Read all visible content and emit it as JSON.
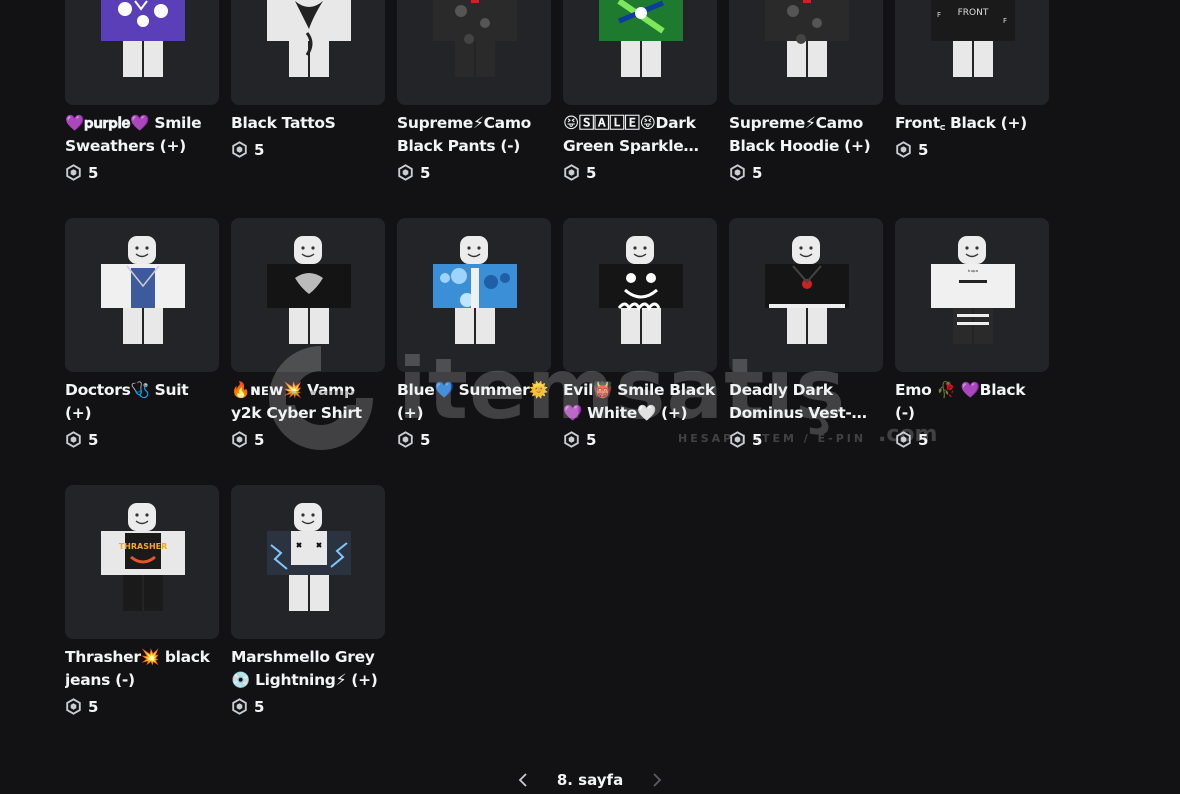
{
  "items": [
    {
      "name": "💜𝐩𝐮𝐫𝐩𝐥𝐞💜 Smile Sweathers (+)",
      "price": "5",
      "shirt": "#5b3fb8",
      "pattern": "purple",
      "legs": "#e8e8e8"
    },
    {
      "name": "Black TattoS",
      "price": "5",
      "shirt": "#e8e8e8",
      "pattern": "tattoo",
      "legs": "#e8e8e8"
    },
    {
      "name": "Supreme⚡Camo Black Pants (-)",
      "price": "5",
      "shirt": "#2a2a2a",
      "pattern": "camo",
      "legs": "#2a2a2a"
    },
    {
      "name": "😝🅂🄰🄻🄴😝Dark Green Sparkle Hoodie",
      "price": "5",
      "shirt": "#1d7a2e",
      "pattern": "green",
      "legs": "#e8e8e8"
    },
    {
      "name": "Supreme⚡Camo Black Hoodie (+)",
      "price": "5",
      "shirt": "#2a2a2a",
      "pattern": "camo",
      "legs": "#e8e8e8"
    },
    {
      "name": "Front꜀ Black (+)",
      "price": "5",
      "shirt": "#1a1a1a",
      "pattern": "front",
      "legs": "#e8e8e8"
    },
    {
      "name": "Doctors🩺 Suit (+)",
      "price": "5",
      "shirt": "#f0f0f0",
      "pattern": "doctor",
      "legs": "#e8e8e8"
    },
    {
      "name": "🔥ɴᴇᴡ💥 Vamp y2k Cyber Shirt",
      "price": "5",
      "shirt": "#141414",
      "pattern": "vamp",
      "legs": "#e8e8e8"
    },
    {
      "name": "Blue💙 Summer🌞 (+)",
      "price": "5",
      "shirt": "#3a8fd6",
      "pattern": "blue",
      "legs": "#e8e8e8"
    },
    {
      "name": "Evil👹 Smile Black 💜 White🤍 (+)",
      "price": "5",
      "shirt": "#151515",
      "pattern": "evil",
      "legs": "#e8e8e8"
    },
    {
      "name": "Deadly Dark Dominus Vest-Cape Set",
      "price": "5",
      "shirt": "#151515",
      "pattern": "deadly",
      "legs": "#e8e8e8"
    },
    {
      "name": "Emo 🥀 💜Black (-)",
      "price": "5",
      "shirt": "#f0f0f0",
      "pattern": "emo",
      "legs": "#2a2a2a"
    },
    {
      "name": "Thrasher💥 black jeans (-)",
      "price": "5",
      "shirt": "#e8e8e8",
      "pattern": "thrasher",
      "legs": "#1a1a1a"
    },
    {
      "name": "Marshmello Grey💿 Lightning⚡ (+)",
      "price": "5",
      "shirt": "#2b3340",
      "pattern": "marsh",
      "legs": "#e8e8e8"
    }
  ],
  "pagination": {
    "label": "8. sayfa",
    "prev_icon": "chevron-left-icon",
    "next_icon": "chevron-right-icon"
  },
  "watermark": {
    "brand": "itemsatış",
    "tagline": "HESAP / ITEM / E-PIN",
    "domain": ".com"
  },
  "colors": {
    "background": "#121215",
    "card": "#232427",
    "text": "#f2f4f5",
    "muted": "#7a7d82"
  }
}
